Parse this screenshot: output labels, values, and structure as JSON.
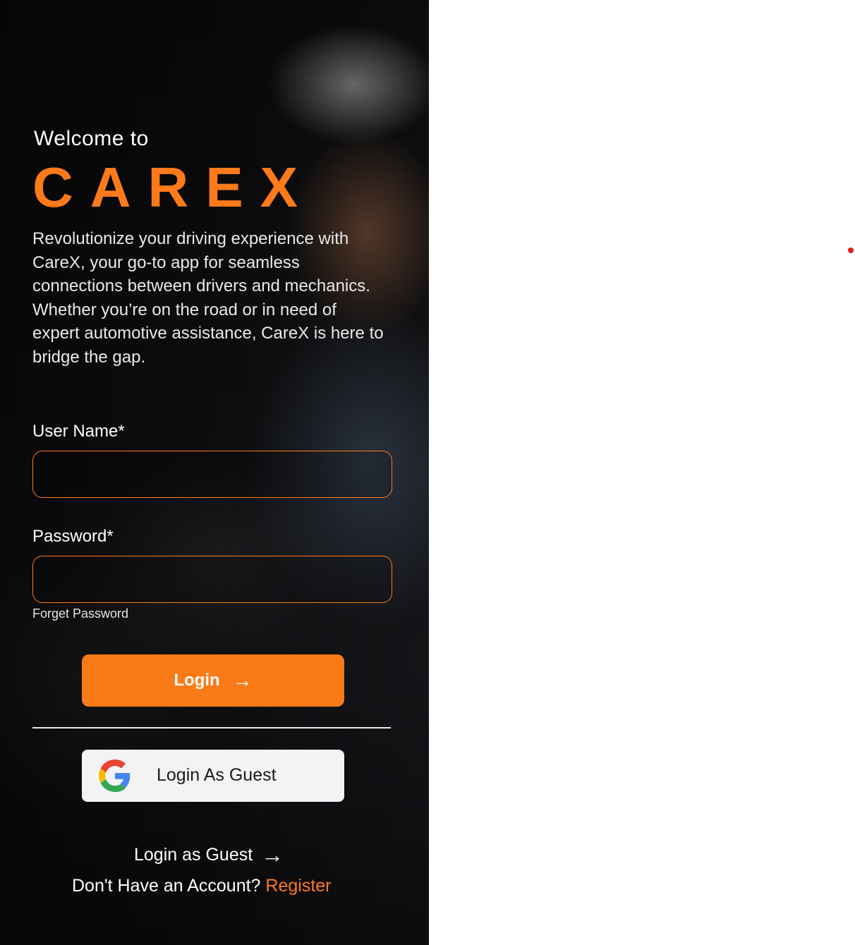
{
  "welcome": "Welcome to",
  "brand": "CAREX",
  "tagline": "Revolutionize your driving experience with CareX, your go-to app for seamless connections between drivers and mechanics. Whether you’re on the road or in need of expert automotive assistance, CareX is here to bridge the gap.",
  "form": {
    "username_label": "User Name*",
    "username_value": "",
    "password_label": "Password*",
    "password_value": "",
    "forgot": "Forget Password",
    "login_button": "Login",
    "login_arrow": "→"
  },
  "guest_button": "Login As Guest",
  "guest_link": "Login as Guest",
  "guest_link_arrow": "→",
  "register_prompt": "Don't Have an Account?",
  "register_link": "Register",
  "colors": {
    "accent": "#fb7a18",
    "panel_bg": "#0b0b0c",
    "guest_button_bg": "#f3f3f5"
  },
  "icons": [
    "arrow-right-icon",
    "google-icon"
  ]
}
